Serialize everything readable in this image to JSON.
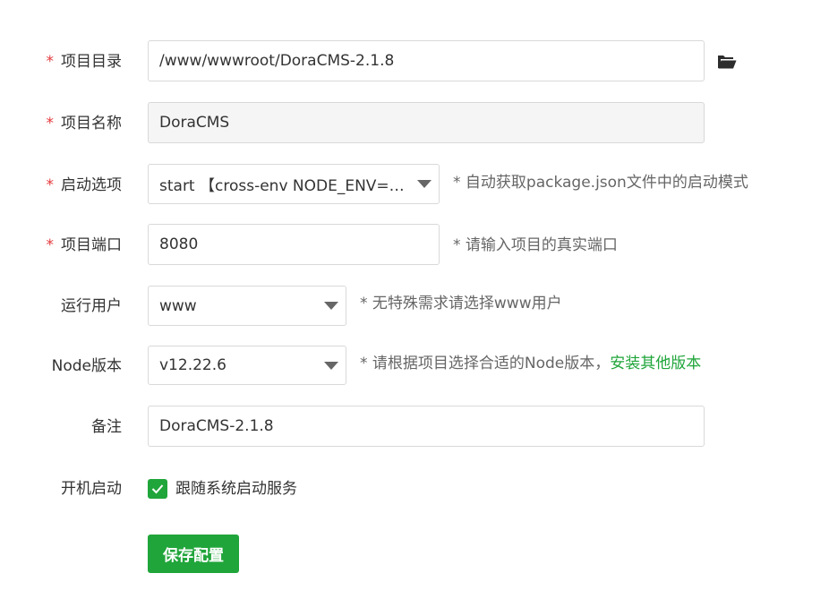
{
  "form": {
    "project_dir": {
      "required_mark": "*",
      "label": "项目目录",
      "value": "/www/wwwroot/DoraCMS-2.1.8",
      "browse_icon": "folder-open-icon"
    },
    "project_name": {
      "required_mark": "*",
      "label": "项目名称",
      "value": "DoraCMS"
    },
    "start_option": {
      "required_mark": "*",
      "label": "启动选项",
      "value": "start 【cross-env NODE_ENV=pr...",
      "hint": "* 自动获取package.json文件中的启动模式"
    },
    "project_port": {
      "required_mark": "*",
      "label": "项目端口",
      "value": "8080",
      "hint": "* 请输入项目的真实端口"
    },
    "run_user": {
      "label": "运行用户",
      "value": "www",
      "hint": "* 无特殊需求请选择www用户"
    },
    "node_version": {
      "label": "Node版本",
      "value": "v12.22.6",
      "hint": "* 请根据项目选择合适的Node版本，",
      "hint_link": "安装其他版本"
    },
    "remark": {
      "label": "备注",
      "value": "DoraCMS-2.1.8"
    },
    "autostart": {
      "label": "开机启动",
      "checkbox_label": "跟随系统启动服务",
      "checked": true
    },
    "save_button": "保存配置"
  },
  "colors": {
    "accent": "#20a53a",
    "required": "#e4393c",
    "border": "#d9d9d9",
    "readonly_bg": "#f5f5f5"
  }
}
